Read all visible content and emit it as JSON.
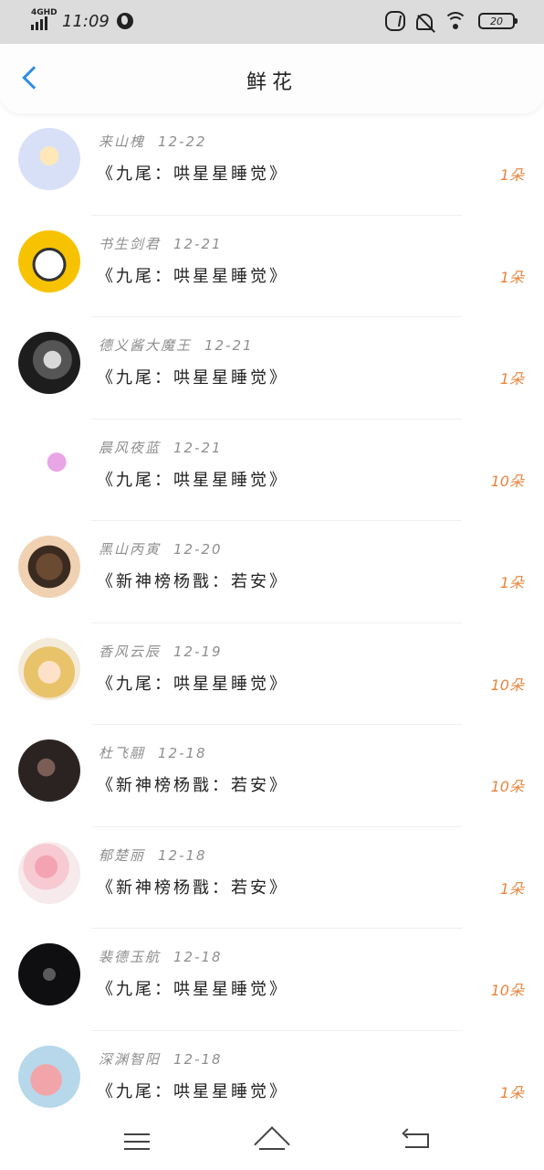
{
  "status_bar": {
    "network": "4GHD",
    "time": "11:09",
    "battery": "20"
  },
  "header": {
    "title": "鲜花"
  },
  "items": [
    {
      "user": "来山槐",
      "date": "12-22",
      "book": "《九尾：哄星星睡觉》",
      "count": "1朵",
      "avatar": "cartoon-bear-avatar"
    },
    {
      "user": "书生剑君",
      "date": "12-21",
      "book": "《九尾：哄星星睡觉》",
      "count": "1朵",
      "avatar": "panda-avatar"
    },
    {
      "user": "德义酱大魔王",
      "date": "12-21",
      "book": "《九尾：哄星星睡觉》",
      "count": "1朵",
      "avatar": "grayscale-portrait-avatar"
    },
    {
      "user": "晨风夜蓝",
      "date": "12-21",
      "book": "《九尾：哄星星睡觉》",
      "count": "10朵",
      "avatar": "teletubby-avatar"
    },
    {
      "user": "黑山丙寅",
      "date": "12-20",
      "book": "《新神榜杨戬：若安》",
      "count": "1朵",
      "avatar": "man-portrait-avatar"
    },
    {
      "user": "香风云辰",
      "date": "12-19",
      "book": "《九尾：哄星星睡觉》",
      "count": "10朵",
      "avatar": "anime-girl-avatar"
    },
    {
      "user": "杜飞翮",
      "date": "12-18",
      "book": "《新神榜杨戬：若安》",
      "count": "10朵",
      "avatar": "dark-portrait-avatar"
    },
    {
      "user": "郁楚丽",
      "date": "12-18",
      "book": "《新神榜杨戬：若安》",
      "count": "1朵",
      "avatar": "pink-balloons-avatar"
    },
    {
      "user": "裴德玉航",
      "date": "12-18",
      "book": "《九尾：哄星星睡觉》",
      "count": "10朵",
      "avatar": "night-portrait-avatar"
    },
    {
      "user": "深渊智阳",
      "date": "12-18",
      "book": "《九尾：哄星星睡觉》",
      "count": "1朵",
      "avatar": "pink-pig-avatar"
    }
  ],
  "colors": {
    "accent": "#2c8de6",
    "count": "#e8843c",
    "meta": "#8e8e8e"
  }
}
